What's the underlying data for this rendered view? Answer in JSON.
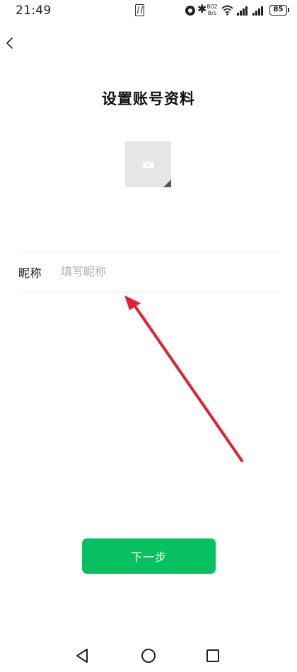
{
  "status_bar": {
    "time": "21:49",
    "net_speed_value": "802",
    "net_speed_unit": "B/s",
    "battery_level": "85",
    "icons": [
      "nfc-icon",
      "alarm-icon",
      "bluetooth-icon",
      "wifi-icon",
      "signal-icon",
      "signal-icon",
      "battery-icon"
    ]
  },
  "header": {
    "back_icon": "chevron-left-icon"
  },
  "page": {
    "title": "设置账号资料"
  },
  "avatar": {
    "icon": "camera-icon",
    "placeholder_color": "#e6e6e6"
  },
  "form": {
    "nickname_label": "昵称",
    "nickname_placeholder": "填写昵称",
    "nickname_value": ""
  },
  "annotation": {
    "type": "arrow",
    "color": "#e3202f"
  },
  "actions": {
    "next_label": "下一步",
    "accent_color": "#07c160"
  },
  "nav_bar": {
    "icons": [
      "nav-back-icon",
      "nav-home-icon",
      "nav-recent-icon"
    ]
  }
}
